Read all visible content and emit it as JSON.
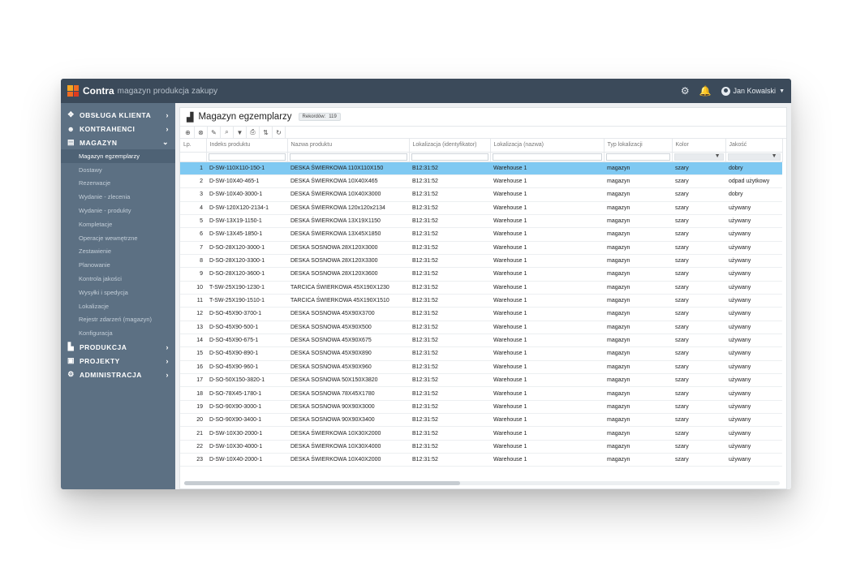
{
  "app": {
    "brand": "Contra",
    "tagline": "magazyn  produkcja  zakupy",
    "user_name": "Jan Kowalski",
    "colors": {
      "topbar": "#3b4a5a",
      "sidebar": "#5c7083",
      "selected_row": "#7fc9f2"
    }
  },
  "sidebar": {
    "sections": [
      {
        "label": "OBSŁUGA KLIENTA",
        "icon": "handshake-icon",
        "expanded": false
      },
      {
        "label": "KONTRAHENCI",
        "icon": "users-icon",
        "expanded": false
      },
      {
        "label": "MAGAZYN",
        "icon": "warehouse-icon",
        "expanded": true,
        "items": [
          "Magazyn egzemplarzy",
          "Dostawy",
          "Rezerwacje",
          "Wydanie - zlecenia",
          "Wydanie - produkty",
          "Kompletacje",
          "Operacje wewnętrzne",
          "Zestawienie",
          "Planowanie",
          "Kontrola jakości",
          "Wysyłki i spedycja",
          "Lokalizacje",
          "Rejestr zdarzeń (magazyn)",
          "Konfiguracja"
        ],
        "active_item": "Magazyn egzemplarzy"
      },
      {
        "label": "PRODUKCJA",
        "icon": "factory-icon",
        "expanded": false
      },
      {
        "label": "PROJEKTY",
        "icon": "briefcase-icon",
        "expanded": false
      },
      {
        "label": "ADMINISTRACJA",
        "icon": "gear-icon",
        "expanded": false
      }
    ]
  },
  "panel": {
    "title": "Magazyn egzemplarzy",
    "records_label": "Rekordów:",
    "records_count": "119"
  },
  "table": {
    "columns": [
      "Lp.",
      "Indeks produktu",
      "Nazwa produktu",
      "Lokalizacja (identyfikator)",
      "Lokalizacja (nazwa)",
      "Typ lokalizacji",
      "Kolor",
      "Jakość"
    ],
    "selected_row": 0,
    "rows": [
      [
        "1",
        "D-SW-110X110-150-1",
        "DESKA ŚWIERKOWA  110X110X150",
        "B12:31:52",
        "Warehouse 1",
        "magazyn",
        "szary",
        "dobry"
      ],
      [
        "2",
        "D-SW-10X40-465-1",
        "DESKA ŚWIERKOWA  10X40X465",
        "B12:31:52",
        "Warehouse 1",
        "magazyn",
        "szary",
        "odpad użytkowy"
      ],
      [
        "3",
        "D-SW-10X40-3000-1",
        "DESKA ŚWIERKOWA  10X40X3000",
        "B12:31:52",
        "Warehouse 1",
        "magazyn",
        "szary",
        "dobry"
      ],
      [
        "4",
        "D-SW-120X120-2134-1",
        "DESKA ŚWIERKOWA  120x120x2134",
        "B12:31:52",
        "Warehouse 1",
        "magazyn",
        "szary",
        "używany"
      ],
      [
        "5",
        "D-SW-13X19-1150-1",
        "DESKA ŚWIERKOWA  13X19X1150",
        "B12:31:52",
        "Warehouse 1",
        "magazyn",
        "szary",
        "używany"
      ],
      [
        "6",
        "D-SW-13X45-1850-1",
        "DESKA ŚWIERKOWA  13X45X1850",
        "B12:31:52",
        "Warehouse 1",
        "magazyn",
        "szary",
        "używany"
      ],
      [
        "7",
        "D-SO-28X120-3000-1",
        "DESKA SOSNOWA  28X120X3000",
        "B12:31:52",
        "Warehouse 1",
        "magazyn",
        "szary",
        "używany"
      ],
      [
        "8",
        "D-SO-28X120-3300-1",
        "DESKA SOSNOWA  28X120X3300",
        "B12:31:52",
        "Warehouse 1",
        "magazyn",
        "szary",
        "używany"
      ],
      [
        "9",
        "D-SO-28X120-3600-1",
        "DESKA SOSNOWA  28X120X3600",
        "B12:31:52",
        "Warehouse 1",
        "magazyn",
        "szary",
        "używany"
      ],
      [
        "10",
        "T-SW-25X190-1230-1",
        "TARCICA ŚWIERKOWA  45X190X1230",
        "B12:31:52",
        "Warehouse 1",
        "magazyn",
        "szary",
        "używany"
      ],
      [
        "11",
        "T-SW-25X190-1510-1",
        "TARCICA ŚWIERKOWA  45X190X1510",
        "B12:31:52",
        "Warehouse 1",
        "magazyn",
        "szary",
        "używany"
      ],
      [
        "12",
        "D-SO-45X90-3700-1",
        "DESKA SOSNOWA  45X90X3700",
        "B12:31:52",
        "Warehouse 1",
        "magazyn",
        "szary",
        "używany"
      ],
      [
        "13",
        "D-SO-45X90-500-1",
        "DESKA SOSNOWA  45X90X500",
        "B12:31:52",
        "Warehouse 1",
        "magazyn",
        "szary",
        "używany"
      ],
      [
        "14",
        "D-SO-45X90-675-1",
        "DESKA SOSNOWA  45X90X675",
        "B12:31:52",
        "Warehouse 1",
        "magazyn",
        "szary",
        "używany"
      ],
      [
        "15",
        "D-SO-45X90-890-1",
        "DESKA SOSNOWA  45X90X890",
        "B12:31:52",
        "Warehouse 1",
        "magazyn",
        "szary",
        "używany"
      ],
      [
        "16",
        "D-SO-45X90-960-1",
        "DESKA SOSNOWA  45X90X960",
        "B12:31:52",
        "Warehouse 1",
        "magazyn",
        "szary",
        "używany"
      ],
      [
        "17",
        "D-SO-50X150-3820-1",
        "DESKA SOSNOWA  50X150X3820",
        "B12:31:52",
        "Warehouse 1",
        "magazyn",
        "szary",
        "używany"
      ],
      [
        "18",
        "D-SO-78X45-1780-1",
        "DESKA SOSNOWA  78X45X1780",
        "B12:31:52",
        "Warehouse 1",
        "magazyn",
        "szary",
        "używany"
      ],
      [
        "19",
        "D-SO-90X90-3000-1",
        "DESKA SOSNOWA  90X90X3000",
        "B12:31:52",
        "Warehouse 1",
        "magazyn",
        "szary",
        "używany"
      ],
      [
        "20",
        "D-SO-90X90-3400-1",
        "DESKA SOSNOWA  90X90X3400",
        "B12:31:52",
        "Warehouse 1",
        "magazyn",
        "szary",
        "używany"
      ],
      [
        "21",
        "D-SW-10X30-2000-1",
        "DESKA ŚWIERKOWA  10X30X2000",
        "B12:31:52",
        "Warehouse 1",
        "magazyn",
        "szary",
        "używany"
      ],
      [
        "22",
        "D-SW-10X30-4000-1",
        "DESKA ŚWIERKOWA  10X30X4000",
        "B12:31:52",
        "Warehouse 1",
        "magazyn",
        "szary",
        "używany"
      ],
      [
        "23",
        "D-SW-10X40-2000-1",
        "DESKA ŚWIERKOWA  10X40X2000",
        "B12:31:52",
        "Warehouse 1",
        "magazyn",
        "szary",
        "używany"
      ]
    ]
  }
}
